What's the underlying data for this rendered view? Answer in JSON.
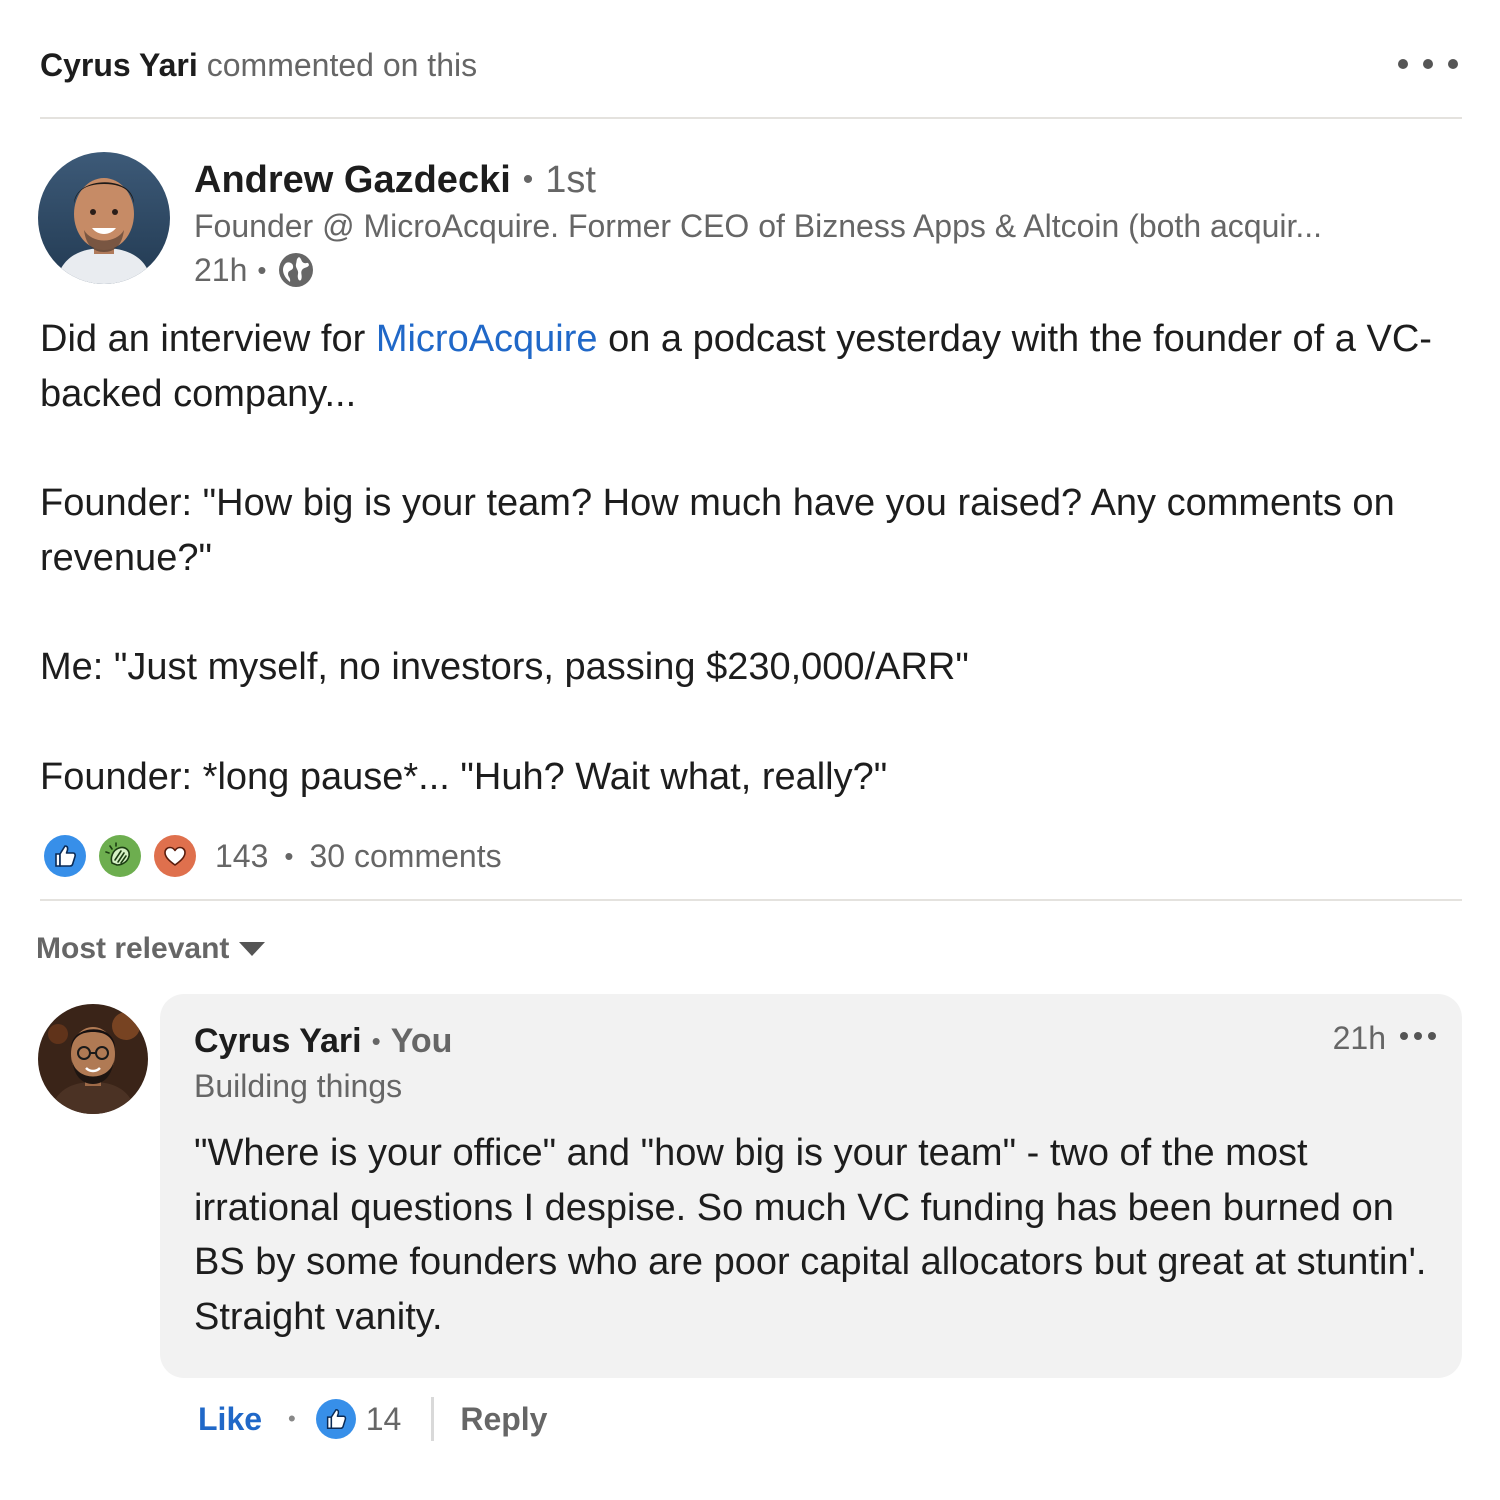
{
  "header": {
    "actor": "Cyrus Yari",
    "activity": "commented on this",
    "more_icon": "more-horizontal-icon"
  },
  "post": {
    "author": {
      "name": "Andrew Gazdecki",
      "degree": "1st",
      "headline": "Founder @ MicroAcquire. Former CEO of Bizness Apps & Altcoin (both acquir...",
      "time": "21h",
      "visibility_icon": "globe-icon"
    },
    "body": {
      "p1_before": "Did an interview for ",
      "p1_mention": "MicroAcquire",
      "p1_after": " on a podcast yesterday with the founder of a VC-backed company...",
      "p2": "Founder: \"How big is your team? How much have you raised? Any comments on revenue?\"",
      "p3": "Me: \"Just myself, no investors, passing $230,000/ARR\"",
      "p4": "Founder: *long pause*... \"Huh? Wait what, really?\""
    },
    "reactions": {
      "icons": [
        "like-icon",
        "celebrate-icon",
        "love-icon"
      ],
      "count": "143",
      "comments": "30 comments"
    }
  },
  "sort": {
    "label": "Most relevant",
    "icon": "caret-down-icon"
  },
  "comment": {
    "name": "Cyrus Yari",
    "badge": "You",
    "headline": "Building things",
    "time": "21h",
    "text": "\"Where is your office\" and \"how big is your team\" - two of the most irrational questions I despise. So much VC funding has been burned on BS by some founders who are poor capital allocators but great at stuntin'. Straight vanity.",
    "actions": {
      "like": "Like",
      "reaction_icon": "like-icon",
      "reaction_count": "14",
      "reply": "Reply"
    }
  },
  "colors": {
    "link_blue": "#2068c8",
    "like_blue": "#378fe9",
    "celebrate_green": "#44712e",
    "love_red": "#df704d",
    "comment_bg": "#f2f2f2",
    "muted_text": "#666666"
  }
}
